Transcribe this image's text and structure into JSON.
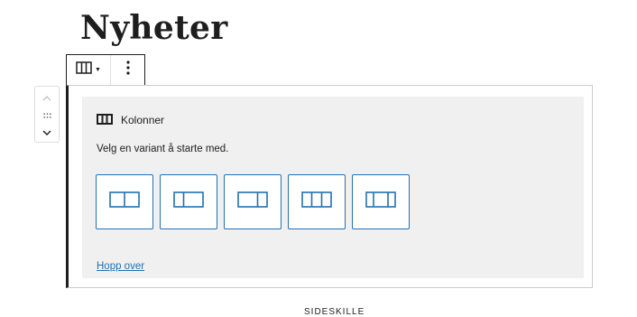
{
  "page": {
    "title": "Nyheter"
  },
  "toolbar": {
    "switcher_icon": "columns-icon",
    "chevron_icon": "chevron-down-icon",
    "more_icon": "more-vertical-icon"
  },
  "movers": {
    "up_icon": "chevron-up-icon",
    "drag_icon": "drag-handle-icon",
    "down_icon": "chevron-down-icon"
  },
  "block": {
    "label": "Kolonner",
    "icon": "columns-icon",
    "instructions": "Velg en variant å starte med.",
    "variations": [
      {
        "icon": "columns-50-50-icon"
      },
      {
        "icon": "columns-33-66-icon"
      },
      {
        "icon": "columns-66-33-icon"
      },
      {
        "icon": "columns-33-33-33-icon"
      },
      {
        "icon": "columns-25-50-25-icon"
      }
    ],
    "skip_label": "Hopp over"
  },
  "separator": {
    "label": "SIDESKILLE"
  },
  "colors": {
    "accent": "#2271b1",
    "text": "#1e1e1e",
    "placeholder_bg": "#f0f0f0"
  }
}
